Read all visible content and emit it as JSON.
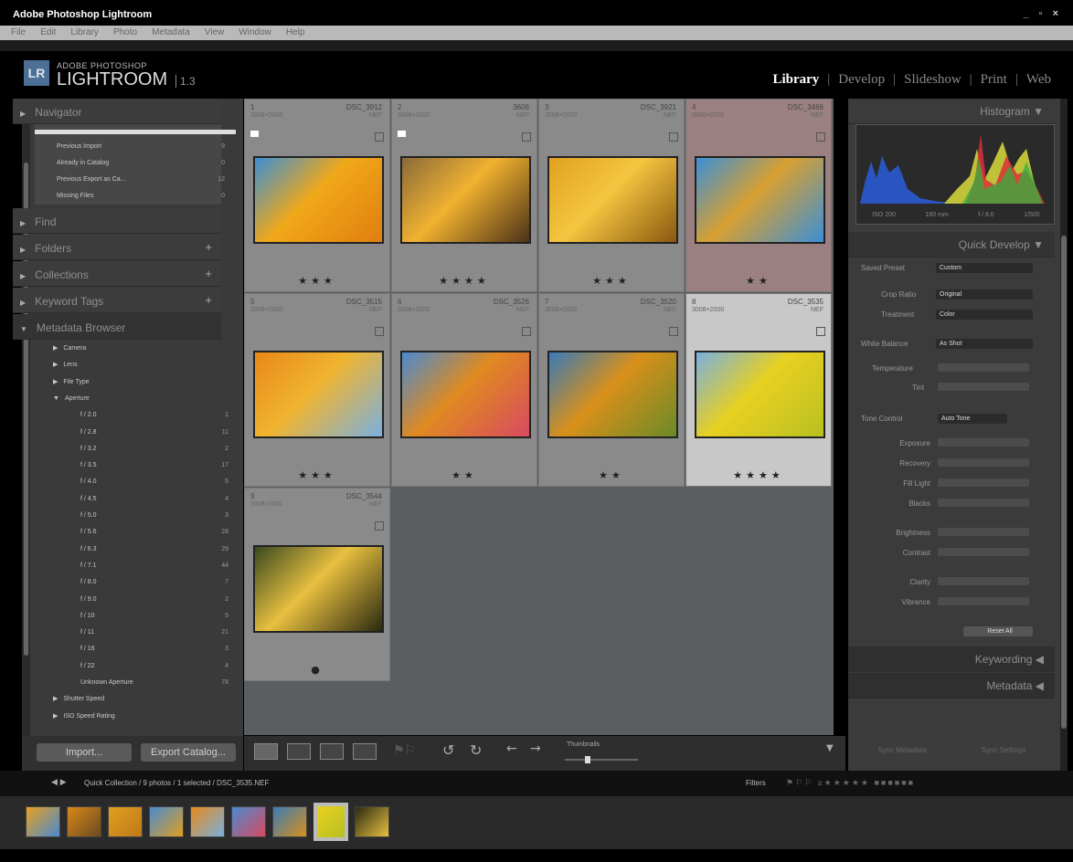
{
  "window": {
    "title": "Adobe Photoshop Lightroom",
    "controls": "_ ▫ ×"
  },
  "menu": [
    "File",
    "Edit",
    "Library",
    "Photo",
    "Metadata",
    "View",
    "Window",
    "Help"
  ],
  "brand": {
    "badge": "LR",
    "top": "ADOBE PHOTOSHOP",
    "main": "LIGHTROOM",
    "version": "1.3"
  },
  "modules": [
    {
      "label": "Library",
      "active": true
    },
    {
      "label": "Develop",
      "active": false
    },
    {
      "label": "Slideshow",
      "active": false
    },
    {
      "label": "Print",
      "active": false
    },
    {
      "label": "Web",
      "active": false
    }
  ],
  "left": {
    "navigator": "Navigator",
    "catalog_items": [
      {
        "label": "Previous Import",
        "count": "9"
      },
      {
        "label": "Already in Catalog",
        "count": "0"
      },
      {
        "label": "Previous Export as Ca...",
        "count": "12"
      },
      {
        "label": "Missing Files",
        "count": "0"
      }
    ],
    "find": "Find",
    "folders": "Folders",
    "collections": "Collections",
    "keyword_tags": "Keyword Tags",
    "metadata_browser": "Metadata Browser",
    "metadata_items": [
      {
        "label": "Camera",
        "level": 0
      },
      {
        "label": "Lens",
        "level": 0
      },
      {
        "label": "File Type",
        "level": 0
      },
      {
        "label": "Aperture",
        "level": 0
      },
      {
        "label": "f / 2.0",
        "level": 1,
        "count": "1"
      },
      {
        "label": "f / 2.8",
        "level": 1,
        "count": "11"
      },
      {
        "label": "f / 3.2",
        "level": 1,
        "count": "2"
      },
      {
        "label": "f / 3.5",
        "level": 1,
        "count": "17"
      },
      {
        "label": "f / 4.0",
        "level": 1,
        "count": "5"
      },
      {
        "label": "f / 4.5",
        "level": 1,
        "count": "4"
      },
      {
        "label": "f / 5.0",
        "level": 1,
        "count": "3"
      },
      {
        "label": "f / 5.6",
        "level": 1,
        "count": "28"
      },
      {
        "label": "f / 6.3",
        "level": 1,
        "count": "29"
      },
      {
        "label": "f / 7.1",
        "level": 1,
        "count": "44"
      },
      {
        "label": "f / 8.0",
        "level": 1,
        "count": "7"
      },
      {
        "label": "f / 9.0",
        "level": 1,
        "count": "2"
      },
      {
        "label": "f / 10",
        "level": 1,
        "count": "5"
      },
      {
        "label": "f / 11",
        "level": 1,
        "count": "21"
      },
      {
        "label": "f / 16",
        "level": 1,
        "count": "3"
      },
      {
        "label": "f / 22",
        "level": 1,
        "count": "4"
      },
      {
        "label": "Unknown Aperture",
        "level": 1,
        "count": "78"
      },
      {
        "label": "Shutter Speed",
        "level": 0
      },
      {
        "label": "ISO Speed Rating",
        "level": 0
      }
    ],
    "import_button": "Import...",
    "export_button": "Export Catalog..."
  },
  "grid": [
    {
      "num": "1",
      "name": "DSC_3912",
      "meta": "3008×2000",
      "type": "NEF",
      "stars": "★★★",
      "flag": true,
      "colors": [
        "#3c8fd6",
        "#f0a818",
        "#e07e10"
      ]
    },
    {
      "num": "2",
      "name": "3606",
      "meta": "3008×2000",
      "type": "NEF",
      "stars": "★★★★",
      "flag": true,
      "colors": [
        "#8a6a3a",
        "#f2b230",
        "#4a3218"
      ]
    },
    {
      "num": "3",
      "name": "DSC_3921",
      "meta": "3008×2000",
      "type": "NEF",
      "stars": "★★★",
      "flag": false,
      "colors": [
        "#e0a020",
        "#f4c640",
        "#8a5810"
      ]
    },
    {
      "num": "4",
      "name": "DSC_3466",
      "meta": "3008×2000",
      "type": "NEF",
      "stars": "★★",
      "flag": false,
      "colors": [
        "#3b8fd8",
        "#d8a030",
        "#3b8fd8"
      ]
    },
    {
      "num": "5",
      "name": "DSC_3515",
      "meta": "3008×2000",
      "type": "NEF",
      "stars": "★★★",
      "flag": false,
      "colors": [
        "#e88818",
        "#f0b430",
        "#7ab0e0"
      ]
    },
    {
      "num": "6",
      "name": "DSC_3526",
      "meta": "3008×2000",
      "type": "NEF",
      "stars": "★★",
      "flag": false,
      "colors": [
        "#4a8ad0",
        "#e08a20",
        "#d84a60"
      ]
    },
    {
      "num": "7",
      "name": "DSC_3520",
      "meta": "3008×2000",
      "type": "NEF",
      "stars": "★★",
      "flag": false,
      "colors": [
        "#3a7ab8",
        "#d8901a",
        "#6a8a2a"
      ]
    },
    {
      "num": "8",
      "name": "DSC_3535",
      "meta": "3008×2000",
      "type": "NEF",
      "stars": "★★★★",
      "flag": false,
      "colors": [
        "#7ab0e0",
        "#e8d020",
        "#b8c020"
      ]
    },
    {
      "num": "9",
      "name": "DSC_3544",
      "meta": "3008×2000",
      "type": "NEF",
      "stars": "●",
      "flag": false,
      "colors": [
        "#3a4a20",
        "#e8c040",
        "#2a2a10"
      ]
    }
  ],
  "right": {
    "histogram": "Histogram",
    "exif": [
      "ISO 200",
      "180 mm",
      "f / 8.0",
      "1/500"
    ],
    "quick_develop": "Quick Develop",
    "saved_preset_label": "Saved Preset",
    "saved_preset_value": "Custom",
    "crop_ratio_label": "Crop Ratio",
    "crop_ratio_value": "Original",
    "treatment_label": "Treatment",
    "treatment_value": "Color",
    "white_balance_label": "White Balance",
    "white_balance_value": "As Shot",
    "temperature_label": "Temperature",
    "tint_label": "Tint",
    "tone_control_label": "Tone Control",
    "auto_tone": "Auto Tone",
    "tone_rows": [
      "Exposure",
      "Recovery",
      "Fill Light",
      "Blacks",
      "Brightness",
      "Contrast",
      "Clarity",
      "Vibrance"
    ],
    "reset_all": "Reset All",
    "keywording": "Keywording",
    "metadata": "Metadata",
    "sync_metadata": "Sync Metadata",
    "sync_settings": "Sync Settings"
  },
  "toolbar": {
    "thumbnails_label": "Thumbnails"
  },
  "filmbar": {
    "path": "Quick Collection / 9 photos / 1 selected / DSC_3535.NEF",
    "filters": "Filters"
  },
  "filmstrip": [
    {
      "colors": [
        "#e8a020",
        "#4a8ad0"
      ]
    },
    {
      "colors": [
        "#d88818",
        "#6a4a20"
      ]
    },
    {
      "colors": [
        "#e0a020",
        "#c07818"
      ]
    },
    {
      "colors": [
        "#4a8ad0",
        "#e0a020"
      ]
    },
    {
      "colors": [
        "#e88818",
        "#7ab0e0"
      ]
    },
    {
      "colors": [
        "#4a8ad0",
        "#d84a60"
      ]
    },
    {
      "colors": [
        "#3a7ab8",
        "#d8901a"
      ]
    },
    {
      "colors": [
        "#e8d020",
        "#b8c020"
      ]
    },
    {
      "colors": [
        "#2a2a10",
        "#e8c040"
      ]
    }
  ]
}
